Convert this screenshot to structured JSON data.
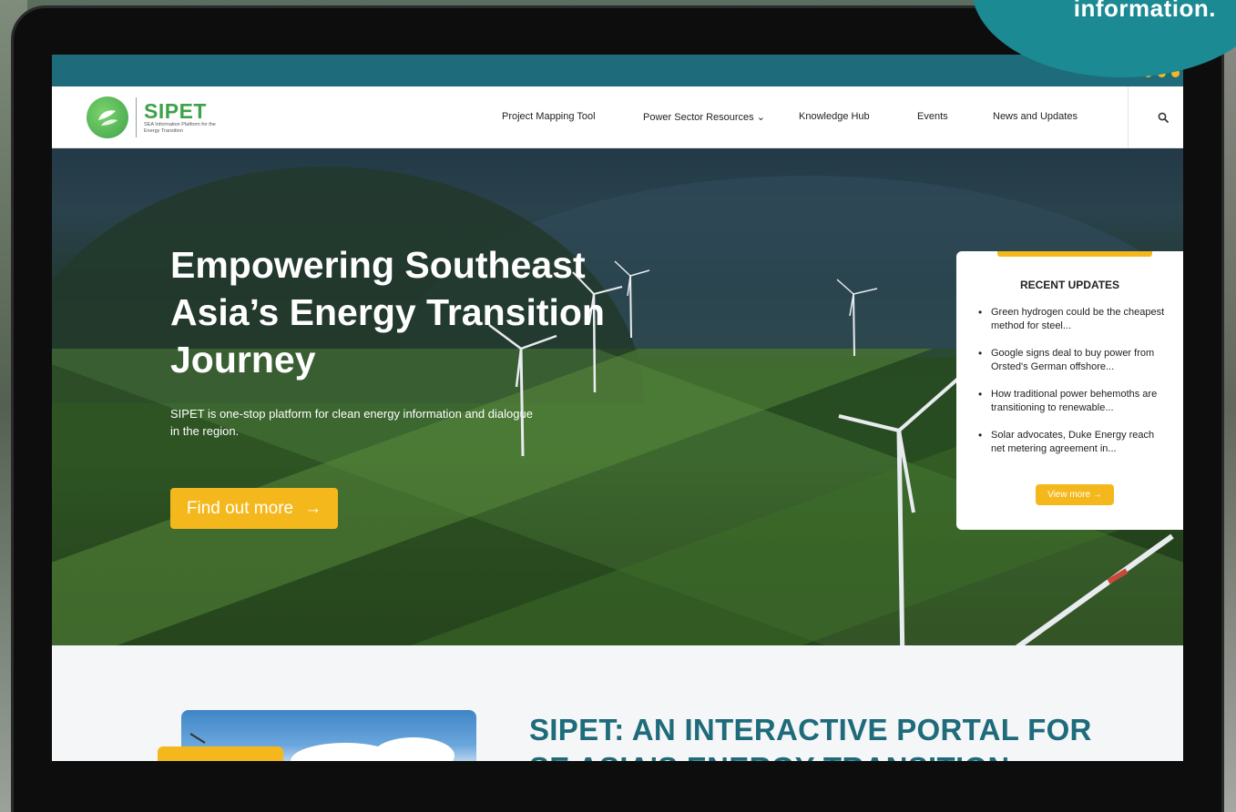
{
  "overlay": {
    "corner_text": "information."
  },
  "nav": {
    "logo_name": "SIPET",
    "logo_tagline": "SEA Information Platform for the Energy Transition",
    "items": [
      {
        "label": "Project Mapping Tool"
      },
      {
        "label": "Power Sector Resources ⌄"
      },
      {
        "label": "Knowledge Hub"
      },
      {
        "label": "Events"
      },
      {
        "label": "News and Updates"
      }
    ],
    "search_icon": "search-icon"
  },
  "hero": {
    "title": "Empowering Southeast Asia’s Energy Transition Journey",
    "subtitle": "SIPET is one-stop platform for clean energy information and dialogue in the region.",
    "cta_label": "Find out more",
    "cta_arrow": "→"
  },
  "updates": {
    "title": "RECENT UPDATES",
    "items": [
      {
        "text": "Green hydrogen could be the cheapest method for steel..."
      },
      {
        "text": "Google signs deal to buy power from Orsted's German offshore..."
      },
      {
        "text": "How traditional power behemoths are transitioning to renewable..."
      },
      {
        "text": "Solar advocates, Duke Energy reach net metering agreement in..."
      }
    ],
    "view_more_label": "View more →"
  },
  "lower": {
    "heading_line1": "SIPET: AN INTERACTIVE PORTAL FOR",
    "heading_line2": "SE ASIA'S ENERGY TRANSITION"
  },
  "colors": {
    "brand_teal": "#1e6b7b",
    "brand_green": "#3ea24a",
    "accent_yellow": "#f5b81c"
  }
}
